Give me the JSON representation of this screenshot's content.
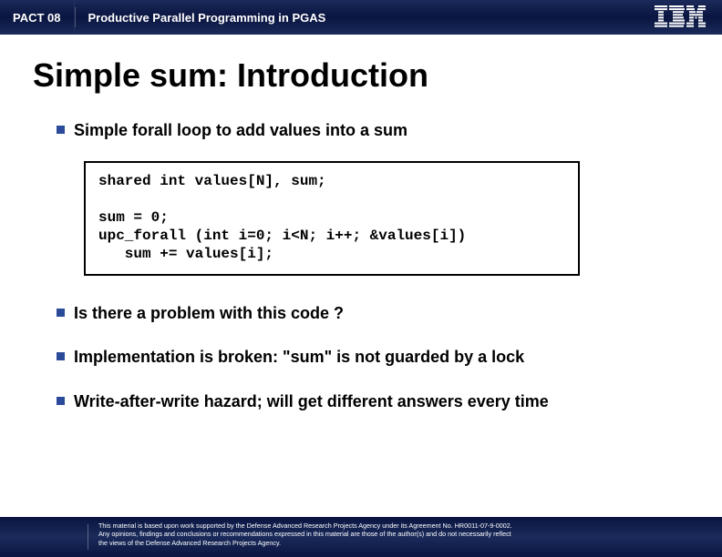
{
  "header": {
    "conference": "PACT 08",
    "subtitle": "Productive Parallel Programming in PGAS",
    "logo_name": "IBM"
  },
  "slide": {
    "title": "Simple sum: Introduction",
    "bullets": [
      "Simple forall loop to add values into a sum",
      "Is there a problem with this code ?",
      "Implementation is broken: \"sum\" is not guarded by a lock",
      "Write-after-write hazard; will get different answers every time"
    ],
    "code": "shared int values[N], sum;\n\nsum = 0;\nupc_forall (int i=0; i<N; i++; &values[i])\n   sum += values[i];"
  },
  "footer": {
    "disclaimer": "This material is based upon work supported by the Defense Advanced Research Projects Agency under its Agreement No. HR0011-07-9-0002.\nAny opinions, findings and conclusions or recommendations expressed in this material are those of the  author(s) and do not necessarily reflect\nthe views of the Defense Advanced Research Projects Agency."
  }
}
